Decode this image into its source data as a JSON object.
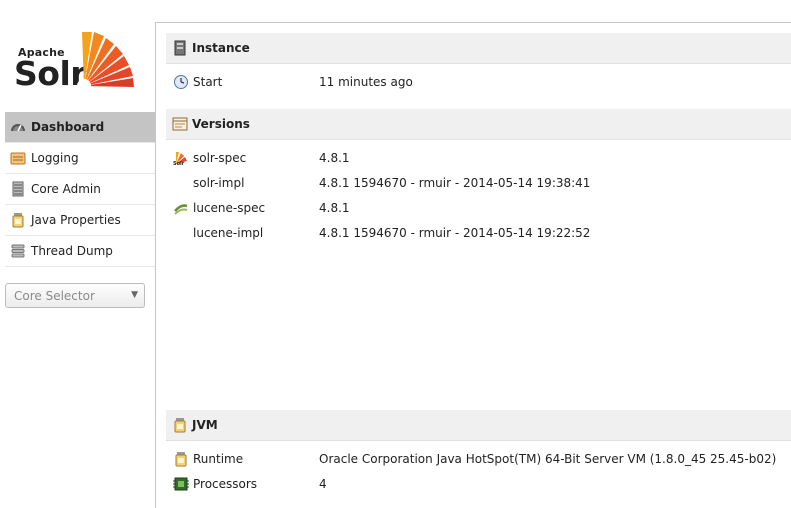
{
  "logo": {
    "apache": "Apache",
    "solr": "Solr"
  },
  "sidebar": {
    "items": [
      {
        "label": "Dashboard",
        "icon": "dashboard-icon",
        "active": true
      },
      {
        "label": "Logging",
        "icon": "logging-icon"
      },
      {
        "label": "Core Admin",
        "icon": "core-admin-icon"
      },
      {
        "label": "Java Properties",
        "icon": "java-properties-icon"
      },
      {
        "label": "Thread Dump",
        "icon": "thread-dump-icon"
      }
    ],
    "core_selector": "Core Selector"
  },
  "instance": {
    "title": "Instance",
    "start_label": "Start",
    "start_value": "11 minutes ago"
  },
  "versions": {
    "title": "Versions",
    "rows": [
      {
        "key": "solr-spec",
        "value": "4.8.1"
      },
      {
        "key": "solr-impl",
        "value": "4.8.1 1594670 - rmuir - 2014-05-14 19:38:41"
      },
      {
        "key": "lucene-spec",
        "value": "4.8.1"
      },
      {
        "key": "lucene-impl",
        "value": "4.8.1 1594670 - rmuir - 2014-05-14 19:22:52"
      }
    ]
  },
  "jvm": {
    "title": "JVM",
    "runtime_label": "Runtime",
    "runtime_value": "Oracle Corporation Java HotSpot(TM) 64-Bit Server VM (1.8.0_45 25.45-b02)",
    "processors_label": "Processors",
    "processors_value": "4"
  },
  "colors": {
    "accent": "#e8552d",
    "active_menu": "#c4c4c4",
    "section_bg": "#f0f0f0"
  }
}
